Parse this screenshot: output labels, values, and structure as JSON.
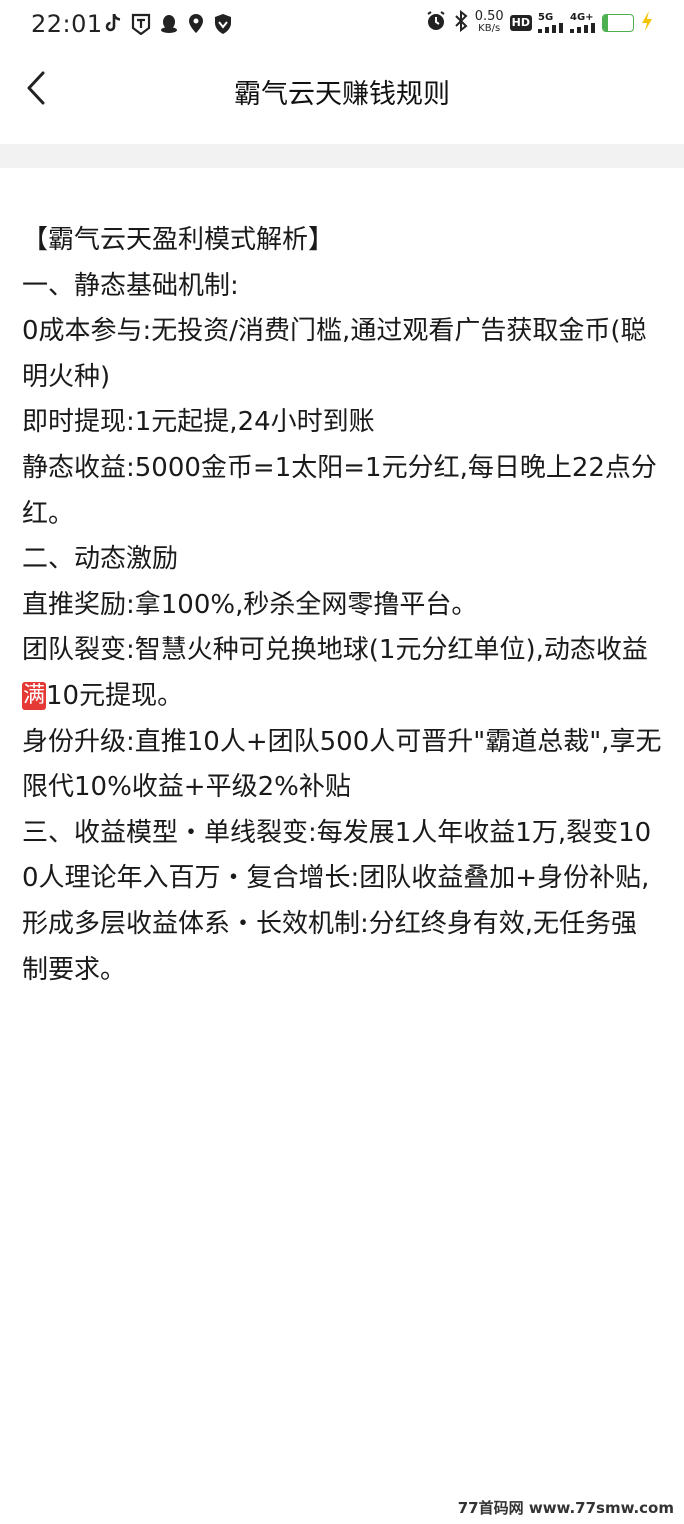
{
  "status_bar": {
    "time": "22:01",
    "left_icons": [
      "tiktok-icon",
      "t-app-icon",
      "qq-icon",
      "location-pin-icon",
      "shield-icon"
    ],
    "right_icons": [
      "alarm-icon",
      "bluetooth-icon"
    ],
    "net_speed_value": "0.50",
    "net_speed_unit": "KB/s",
    "hd_label": "HD",
    "sim2_label": "5G",
    "sim1_label": "4G+",
    "battery_level": "15",
    "battery_fraction": 0.15,
    "battery_color": "#4caf50"
  },
  "nav": {
    "back_icon": "chevron-left-icon",
    "title": "霸气云天赚钱规则"
  },
  "article": {
    "paragraphs": [
      "【霸气云天盈利模式解析】",
      "一、静态基础机制:",
      "0成本参与:无投资/消费门槛,通过观看广告获取金币(聪明火种)",
      "即时提现:1元起提,24小时到账",
      "静态收益:5000金币=1太阳=1元分红,每日晚上22点分红。",
      "二、动态激励",
      "直推奖励:拿100%,秒杀全网零撸平台。",
      "团队裂变:智慧火种可兑换地球(1元分红单位),动态收益",
      "身份升级:直推10人+团队500人可晋升\"霸道总裁\",享无限代10%收益+平级2%补贴",
      "三、收益模型・单线裂变:每发展1人年收益1万,裂变100人理论年入百万・复合增长:团队收益叠加+身份补贴,形成多层收益体系・长效机制:分红终身有效,无任务强制要求。"
    ],
    "badge_text": "满",
    "badge_suffix": "10元提现。"
  },
  "watermark": "77首码网 www.77smw.com",
  "colors": {
    "accent_red": "#e53935",
    "background": "#ffffff",
    "separator": "#f2f2f2"
  }
}
